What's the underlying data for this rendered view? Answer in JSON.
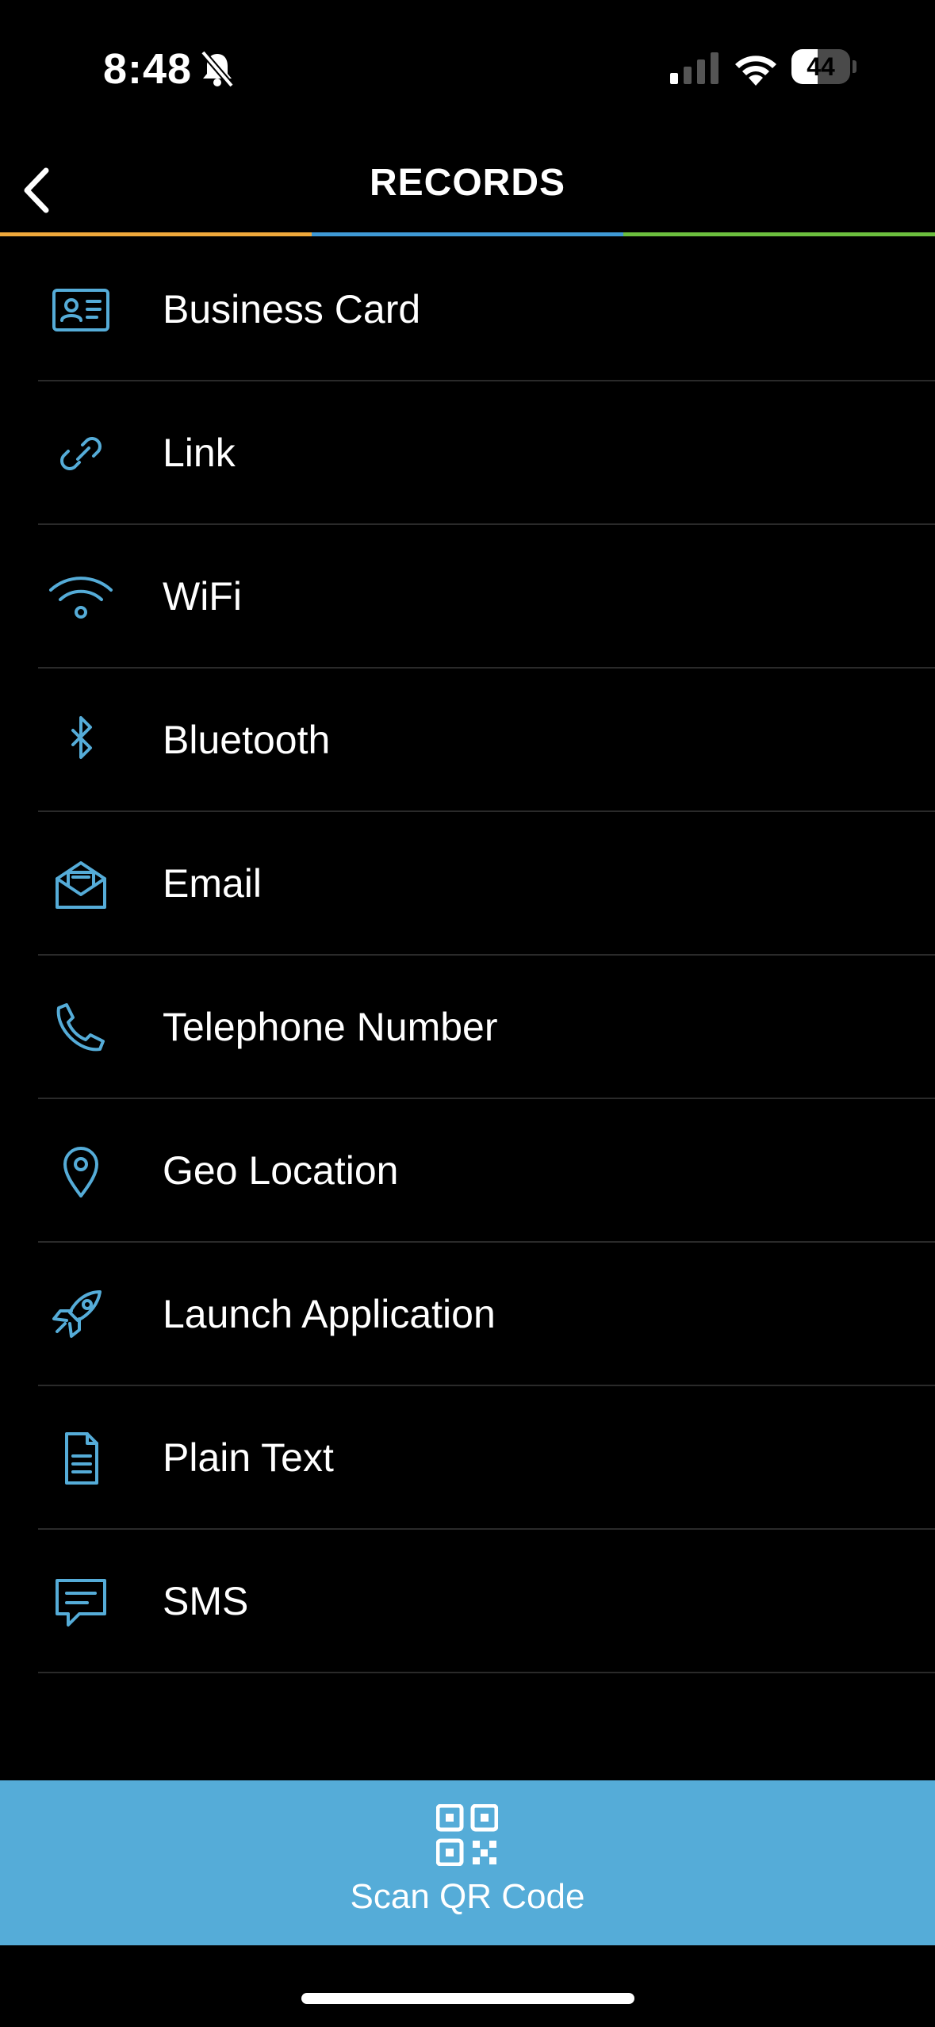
{
  "status_bar": {
    "time": "8:48",
    "battery": "44",
    "battery_level": 0.44
  },
  "nav": {
    "title": "RECORDS"
  },
  "colors": {
    "accent": "#55acd8",
    "tab_orange": "#f0a93b",
    "tab_blue": "#3f9ad6",
    "tab_green": "#6cbf3e"
  },
  "records": [
    {
      "label": "Business Card",
      "icon": "business-card-icon"
    },
    {
      "label": "Link",
      "icon": "link-icon"
    },
    {
      "label": "WiFi",
      "icon": "wifi-icon"
    },
    {
      "label": "Bluetooth",
      "icon": "bluetooth-icon"
    },
    {
      "label": "Email",
      "icon": "email-icon"
    },
    {
      "label": "Telephone Number",
      "icon": "phone-icon"
    },
    {
      "label": "Geo Location",
      "icon": "location-pin-icon"
    },
    {
      "label": "Launch Application",
      "icon": "rocket-icon"
    },
    {
      "label": "Plain Text",
      "icon": "document-icon"
    },
    {
      "label": "SMS",
      "icon": "chat-icon"
    }
  ],
  "scan": {
    "label": "Scan QR Code",
    "icon": "qr-code-icon"
  }
}
